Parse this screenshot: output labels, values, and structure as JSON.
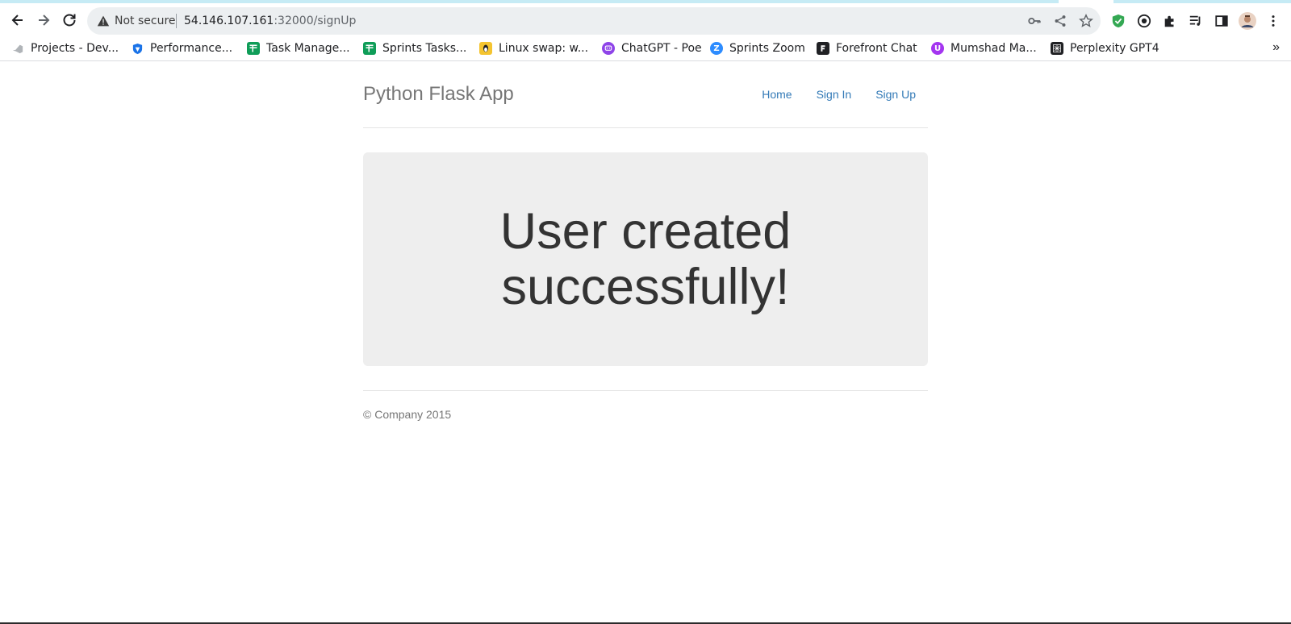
{
  "browser": {
    "security_status": "Not secure",
    "url_host": "54.146.107.161",
    "url_path": ":32000/signUp",
    "more_bookmarks": "»"
  },
  "bookmarks": [
    {
      "label": "Projects - Dev...",
      "icon": "azure-devops-icon",
      "color": "#9aa0a6"
    },
    {
      "label": "Performance...",
      "icon": "shield-logo-icon",
      "color": "#1a73e8"
    },
    {
      "label": "Task Manage...",
      "icon": "sheets-icon",
      "color": "#0f9d58"
    },
    {
      "label": "Sprints Tasks...",
      "icon": "sheets-icon",
      "color": "#0f9d58"
    },
    {
      "label": "Linux swap: w...",
      "icon": "linux-tux-icon",
      "color": "#f4b400"
    },
    {
      "label": "ChatGPT - Poe",
      "icon": "poe-icon",
      "color": "#8e44e8"
    },
    {
      "label": "Sprints Zoom",
      "icon": "zoom-icon",
      "color": "#2d8cff"
    },
    {
      "label": "Forefront Chat",
      "icon": "forefront-icon",
      "color": "#202124"
    },
    {
      "label": "Mumshad Ma...",
      "icon": "udemy-icon",
      "color": "#a435f0"
    },
    {
      "label": "Perplexity GPT4",
      "icon": "perplexity-icon",
      "color": "#202124"
    }
  ],
  "app": {
    "brand": "Python Flask App",
    "nav": [
      "Home",
      "Sign In",
      "Sign Up"
    ],
    "message": "User created successfully!",
    "footer": "© Company 2015"
  },
  "colors": {
    "link": "#337ab7",
    "jumbotron_bg": "#eeeeee",
    "brand_text": "#777777"
  }
}
